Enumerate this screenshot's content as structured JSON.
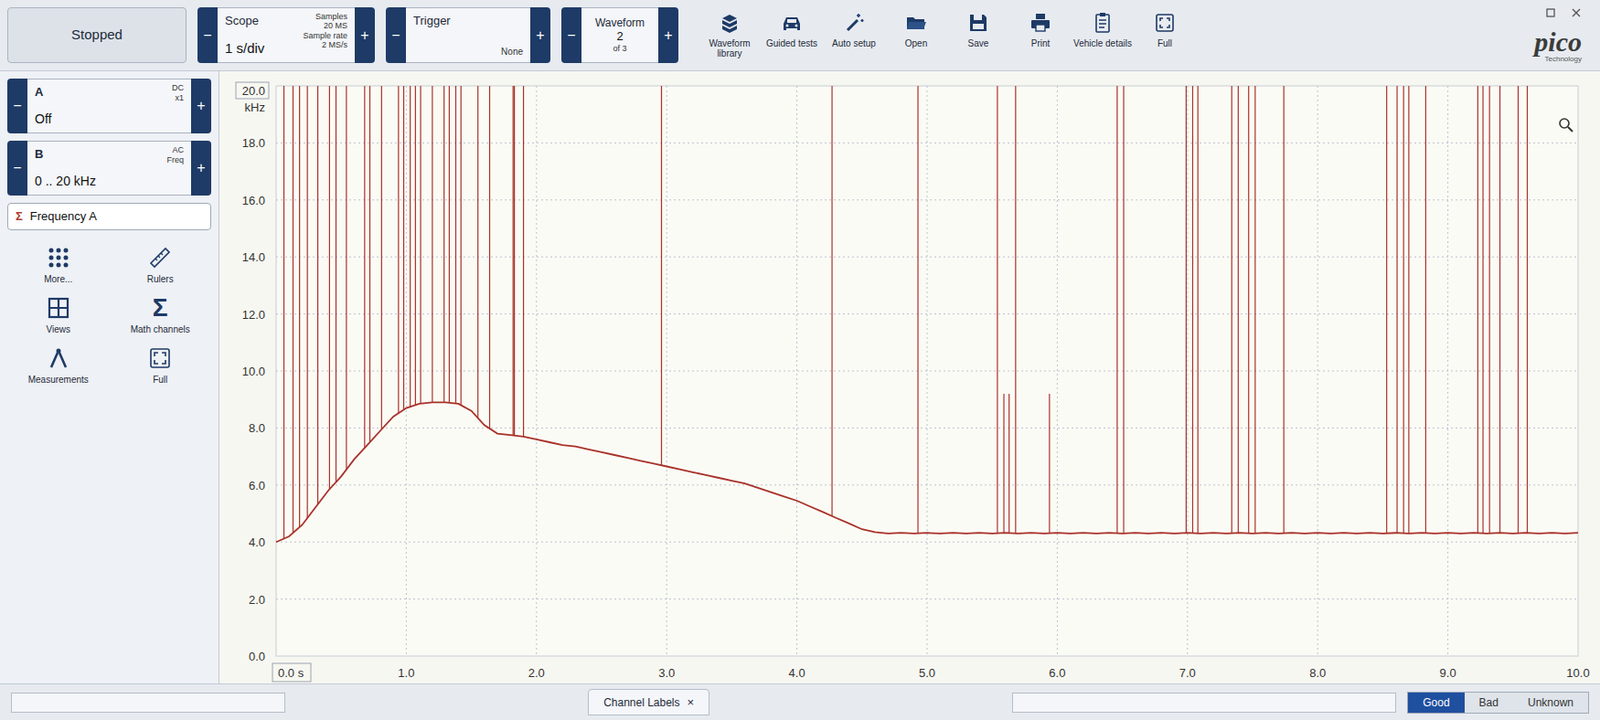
{
  "toolbar": {
    "run_button": "Stopped",
    "step": {
      "minus": "−",
      "plus": "+"
    },
    "scope": {
      "title": "Scope",
      "value": "1 s/div",
      "samples_label": "Samples",
      "samples": "20 MS",
      "rate_label": "Sample rate",
      "rate": "2 MS/s"
    },
    "trigger": {
      "title": "Trigger",
      "value": "None"
    },
    "waveform": {
      "title": "Waveform",
      "value": "2",
      "of": "of 3"
    },
    "tools": [
      {
        "label": "Waveform library"
      },
      {
        "label": "Guided tests"
      },
      {
        "label": "Auto setup"
      },
      {
        "label": "Open"
      },
      {
        "label": "Save"
      },
      {
        "label": "Print"
      },
      {
        "label": "Vehicle details"
      },
      {
        "label": "Full"
      }
    ]
  },
  "logo": {
    "text": "pico",
    "subtitle": "Technology"
  },
  "channels": [
    {
      "name": "A",
      "coupling": "DC",
      "probe": "x1",
      "range": "Off"
    },
    {
      "name": "B",
      "coupling": "AC",
      "probe": "Freq",
      "range": "0 .. 20 kHz"
    }
  ],
  "math_channel": {
    "symbol": "Σ",
    "label": "Frequency A"
  },
  "side_tools": [
    {
      "label": "More..."
    },
    {
      "label": "Rulers"
    },
    {
      "label": "Views"
    },
    {
      "label": "Math channels",
      "glyph": "Σ"
    },
    {
      "label": "Measurements"
    },
    {
      "label": "Full"
    }
  ],
  "chart": {
    "y_unit": "kHz",
    "y_ticks": [
      {
        "label": "20.0",
        "value": 20
      },
      {
        "label": "18.0",
        "value": 18
      },
      {
        "label": "16.0",
        "value": 16
      },
      {
        "label": "14.0",
        "value": 14
      },
      {
        "label": "12.0",
        "value": 12
      },
      {
        "label": "10.0",
        "value": 10
      },
      {
        "label": "8.0",
        "value": 8
      },
      {
        "label": "6.0",
        "value": 6
      },
      {
        "label": "4.0",
        "value": 4
      },
      {
        "label": "2.0",
        "value": 2
      },
      {
        "label": "0.0",
        "value": 0
      }
    ],
    "x_ticks": [
      {
        "label": "0.0 s",
        "value": 0
      },
      {
        "label": "1.0",
        "value": 1
      },
      {
        "label": "2.0",
        "value": 2
      },
      {
        "label": "3.0",
        "value": 3
      },
      {
        "label": "4.0",
        "value": 4
      },
      {
        "label": "5.0",
        "value": 5
      },
      {
        "label": "6.0",
        "value": 6
      },
      {
        "label": "7.0",
        "value": 7
      },
      {
        "label": "8.0",
        "value": 8
      },
      {
        "label": "9.0",
        "value": 9
      },
      {
        "label": "10.0",
        "value": 10
      }
    ],
    "sample_interval_s": 0.1,
    "trace": [
      4.0,
      4.2,
      4.6,
      5.2,
      5.8,
      6.3,
      6.9,
      7.4,
      7.9,
      8.4,
      8.7,
      8.85,
      8.9,
      8.9,
      8.85,
      8.6,
      8.1,
      7.8,
      7.75,
      7.7,
      7.6,
      7.5,
      7.4,
      7.35,
      7.25,
      7.15,
      7.05,
      6.95,
      6.85,
      6.75,
      6.65,
      6.55,
      6.45,
      6.35,
      6.25,
      6.15,
      6.05,
      5.9,
      5.75,
      5.6,
      5.45,
      5.25,
      5.05,
      4.85,
      4.65,
      4.45,
      4.35,
      4.3,
      4.32,
      4.3,
      4.32,
      4.3,
      4.32,
      4.3,
      4.32,
      4.3,
      4.32,
      4.3,
      4.32,
      4.3,
      4.32,
      4.3,
      4.32,
      4.3,
      4.32,
      4.3,
      4.32,
      4.3,
      4.32,
      4.3,
      4.32,
      4.3,
      4.32,
      4.3,
      4.32,
      4.3,
      4.32,
      4.3,
      4.32,
      4.3,
      4.32,
      4.3,
      4.32,
      4.3,
      4.32,
      4.3,
      4.32,
      4.3,
      4.32,
      4.3,
      4.32,
      4.3,
      4.32,
      4.3,
      4.32,
      4.3,
      4.32,
      4.3,
      4.32,
      4.3,
      4.32
    ],
    "spikes": [
      {
        "t": 0.06,
        "top": 20
      },
      {
        "t": 0.13,
        "top": 20
      },
      {
        "t": 0.18,
        "top": 20
      },
      {
        "t": 0.24,
        "top": 20
      },
      {
        "t": 0.32,
        "top": 20
      },
      {
        "t": 0.41,
        "top": 20
      },
      {
        "t": 0.46,
        "top": 20
      },
      {
        "t": 0.54,
        "top": 20
      },
      {
        "t": 0.68,
        "top": 20
      },
      {
        "t": 0.72,
        "top": 20
      },
      {
        "t": 0.81,
        "top": 20
      },
      {
        "t": 0.94,
        "top": 20
      },
      {
        "t": 0.98,
        "top": 20
      },
      {
        "t": 1.03,
        "top": 20
      },
      {
        "t": 1.07,
        "top": 20
      },
      {
        "t": 1.11,
        "top": 20
      },
      {
        "t": 1.2,
        "top": 20
      },
      {
        "t": 1.29,
        "top": 20
      },
      {
        "t": 1.33,
        "top": 20
      },
      {
        "t": 1.38,
        "top": 20
      },
      {
        "t": 1.42,
        "top": 20
      },
      {
        "t": 1.55,
        "top": 20
      },
      {
        "t": 1.64,
        "top": 20
      },
      {
        "t": 1.82,
        "top": 20
      },
      {
        "t": 1.83,
        "top": 20
      },
      {
        "t": 1.9,
        "top": 20
      },
      {
        "t": 2.96,
        "top": 20
      },
      {
        "t": 4.27,
        "top": 20
      },
      {
        "t": 4.93,
        "top": 20
      },
      {
        "t": 5.54,
        "top": 20
      },
      {
        "t": 5.59,
        "top": 9.2
      },
      {
        "t": 5.63,
        "top": 9.2
      },
      {
        "t": 5.68,
        "top": 20
      },
      {
        "t": 5.94,
        "top": 9.2
      },
      {
        "t": 6.46,
        "top": 20
      },
      {
        "t": 6.51,
        "top": 20
      },
      {
        "t": 6.99,
        "top": 20
      },
      {
        "t": 7.04,
        "top": 20
      },
      {
        "t": 7.08,
        "top": 20
      },
      {
        "t": 7.34,
        "top": 20
      },
      {
        "t": 7.39,
        "top": 20
      },
      {
        "t": 7.47,
        "top": 20
      },
      {
        "t": 7.52,
        "top": 20
      },
      {
        "t": 7.74,
        "top": 20
      },
      {
        "t": 8.53,
        "top": 20
      },
      {
        "t": 8.61,
        "top": 20
      },
      {
        "t": 8.66,
        "top": 20
      },
      {
        "t": 8.7,
        "top": 20
      },
      {
        "t": 8.83,
        "top": 20
      },
      {
        "t": 9.23,
        "top": 20
      },
      {
        "t": 9.27,
        "top": 20
      },
      {
        "t": 9.32,
        "top": 20
      },
      {
        "t": 9.4,
        "top": 20
      },
      {
        "t": 9.54,
        "top": 20
      },
      {
        "t": 9.61,
        "top": 20
      }
    ]
  },
  "footer": {
    "tab": {
      "label": "Channel Labels",
      "close": "×"
    },
    "rating": [
      {
        "label": "Good",
        "selected": true
      },
      {
        "label": "Bad",
        "selected": false
      },
      {
        "label": "Unknown",
        "selected": false
      }
    ]
  }
}
